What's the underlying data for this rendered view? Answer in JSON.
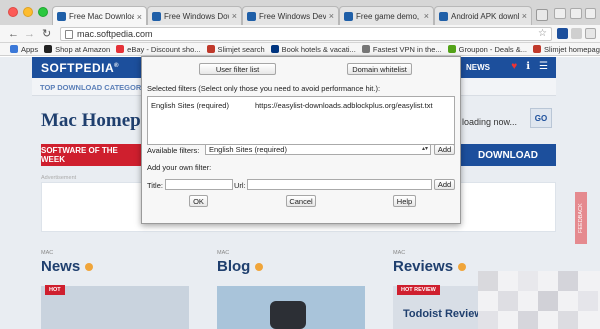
{
  "tabs": [
    {
      "label": "Free Mac Downloads",
      "active": true,
      "favicon_color": "#1f5fa8"
    },
    {
      "label": "Free Windows Downloads",
      "active": false,
      "favicon_color": "#1f5fa8"
    },
    {
      "label": "Free Windows Device",
      "active": false,
      "favicon_color": "#1f5fa8"
    },
    {
      "label": "Free game demo, pat",
      "active": false,
      "favicon_color": "#1f5fa8"
    },
    {
      "label": "Android APK downloads",
      "active": false,
      "favicon_color": "#1f5fa8"
    }
  ],
  "address_bar": {
    "url": "mac.softpedia.com"
  },
  "bookmarks": [
    {
      "label": "Apps",
      "icon_color": "#3b78d8"
    },
    {
      "label": "Shop at Amazon",
      "icon_color": "#222222"
    },
    {
      "label": "eBay - Discount sho...",
      "icon_color": "#e53238"
    },
    {
      "label": "Slimjet search",
      "icon_color": "#c0392b"
    },
    {
      "label": "Book hotels & vacati...",
      "icon_color": "#003580"
    },
    {
      "label": "Fastest VPN in the...",
      "icon_color": "#777777"
    },
    {
      "label": "Groupon - Deals &...",
      "icon_color": "#53a318"
    },
    {
      "label": "Slimjet homepage",
      "icon_color": "#c0392b"
    }
  ],
  "site": {
    "logo": "SOFTPEDIA",
    "logo_mark": "®",
    "news": "NEWS",
    "subnav_label": "TOP DOWNLOAD CATEGORIES",
    "mac_home": "Mac Homep",
    "loading": "loading now...",
    "go": "GO",
    "sotw": "SOFTWARE OF THE WEEK",
    "download": "DOWNLOAD",
    "advert_label": "Advertisement",
    "feedback": "FEEDBACK",
    "columns": [
      {
        "caption": "MAC",
        "title": "News"
      },
      {
        "caption": "MAC",
        "title": "Blog"
      },
      {
        "caption": "MAC",
        "title": "Reviews"
      }
    ],
    "hot_badge": "HOT",
    "hot_review_badge": "HOT REVIEW",
    "todoist": "Todoist Review",
    "brand_blue": "#1c4f9c",
    "brand_red": "#cf1f2e"
  },
  "dialog": {
    "user_filter_btn": "User filter list",
    "domain_whitelist_btn": "Domain whitelist",
    "selected_filters_label": "Selected filters (Select only those you need to avoid performance hit.):",
    "selected_filter_name": "English Sites (required)",
    "selected_filter_url": "https://easylist-downloads.adblockplus.org/easylist.txt",
    "available_filters_label": "Available filters:",
    "available_filter_value": "English Sites (required)",
    "add_btn": "Add",
    "add_own_label": "Add your own filter:",
    "title_label": "Title:",
    "url_label": "Url:",
    "add_btn2": "Add",
    "ok_btn": "OK",
    "cancel_btn": "Cancel",
    "help_btn": "Help"
  }
}
